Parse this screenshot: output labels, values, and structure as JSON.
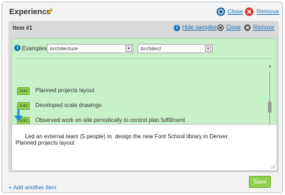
{
  "section": {
    "title": "Experience",
    "close_label": "Close",
    "remove_label": "Remove"
  },
  "item": {
    "title": "Item #1",
    "hide_samples_label": "Hide samples",
    "close_label": "Close",
    "remove_label": "Remove"
  },
  "samples": {
    "examples_label": "Examples:",
    "industry_select": "Architecture",
    "role_select": "Architect",
    "add_label": "Add",
    "rows": [
      "Planned projects layout",
      "Developed scale drawings",
      "Observed work on-site periodically to control plan fulfillment"
    ]
  },
  "editor": {
    "text": "Led an external team (5 people) to  design the new Font School library in Denver.\nPlanned projects layout"
  },
  "footer": {
    "add_another_label": "+ Add another item",
    "save_label": "Save"
  },
  "colors": {
    "link": "#1a6fb5",
    "samples_bg": "#c7f2c9",
    "button_green": "#8fd14f",
    "remove_red": "#d9342b"
  }
}
